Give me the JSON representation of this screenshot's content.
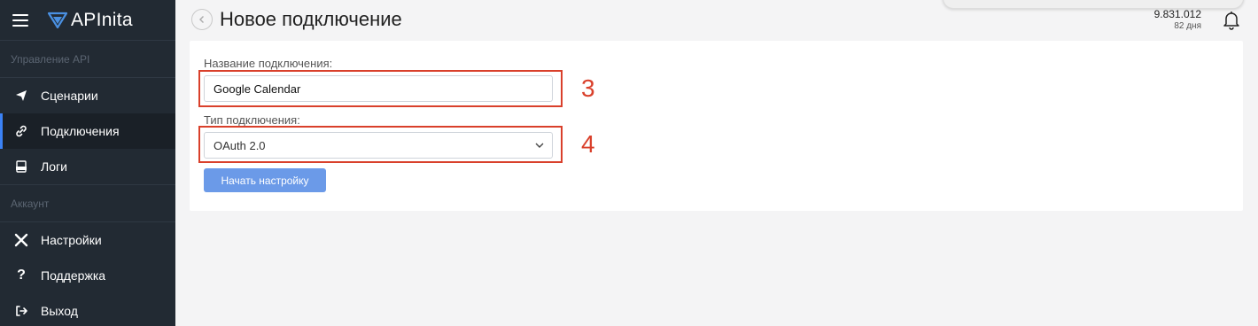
{
  "app": {
    "name": "APInita"
  },
  "sidebar": {
    "section_api": "Управление API",
    "api_items": [
      {
        "label": "Сценарии",
        "icon": "paper-plane-icon"
      },
      {
        "label": "Подключения",
        "icon": "link-icon",
        "active": true
      },
      {
        "label": "Логи",
        "icon": "log-file-icon"
      }
    ],
    "section_account": "Аккаунт",
    "account_items": [
      {
        "label": "Настройки",
        "icon": "tools-icon"
      },
      {
        "label": "Поддержка",
        "icon": "question-icon"
      },
      {
        "label": "Выход",
        "icon": "logout-icon"
      }
    ]
  },
  "header": {
    "title": "Новое подключение",
    "balance": "9.831.012",
    "days": "82 дня"
  },
  "form": {
    "name_label": "Название подключения:",
    "name_value": "Google Calendar",
    "type_label": "Тип подключения:",
    "type_value": "OAuth 2.0",
    "start_button": "Начать настройку"
  },
  "annotations": {
    "step_3": "3",
    "step_4": "4"
  },
  "colors": {
    "sidebar_bg": "#222a33",
    "accent": "#3b82f6",
    "button": "#6b9ae8",
    "highlight": "#d9402b"
  }
}
